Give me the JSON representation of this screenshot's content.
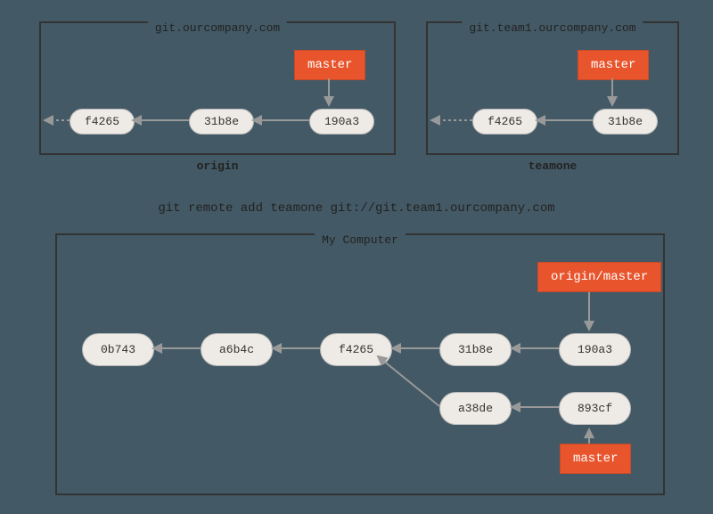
{
  "origin": {
    "title": "git.ourcompany.com",
    "label": "origin",
    "branch": "master",
    "commits": [
      "f4265",
      "31b8e",
      "190a3"
    ]
  },
  "teamone": {
    "title": "git.team1.ourcompany.com",
    "label": "teamone",
    "branch": "master",
    "commits": [
      "f4265",
      "31b8e"
    ]
  },
  "command": "git remote add teamone git://git.team1.ourcompany.com",
  "local": {
    "title": "My Computer",
    "remote_branch": "origin/master",
    "local_branch": "master",
    "row1": [
      "0b743",
      "a6b4c",
      "f4265",
      "31b8e",
      "190a3"
    ],
    "row2": [
      "a38de",
      "893cf"
    ]
  }
}
